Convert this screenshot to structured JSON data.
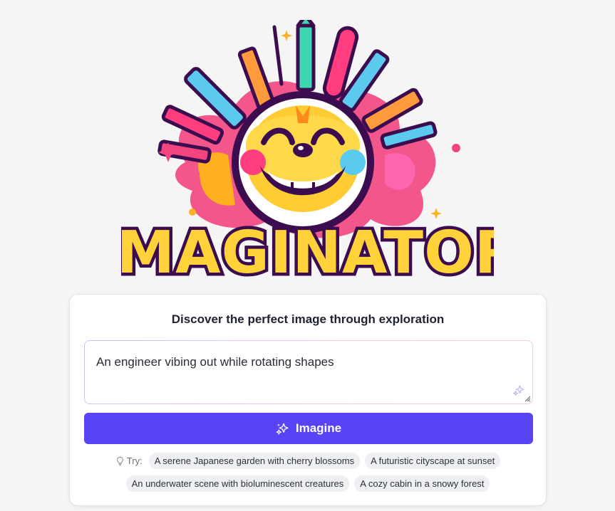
{
  "logo": {
    "text": "IMAGINATOR",
    "icon": "smiling-creature-with-pens-logo"
  },
  "card": {
    "title": "Discover the perfect image through exploration"
  },
  "prompt": {
    "value": "An engineer vibing out while rotating shapes",
    "icon": "sparkles-icon"
  },
  "imagine_button": {
    "label": "Imagine",
    "icon": "sparkles-icon"
  },
  "suggestions": {
    "label": "Try:",
    "icon": "lightbulb-icon",
    "items": [
      "A serene Japanese garden with cherry blossoms",
      "A futuristic cityscape at sunset",
      "An underwater scene with bioluminescent creatures",
      "A cozy cabin in a snowy forest"
    ]
  },
  "colors": {
    "accent": "#5843f5",
    "background": "#f5f5f6",
    "chip_bg": "#eff0f2"
  }
}
